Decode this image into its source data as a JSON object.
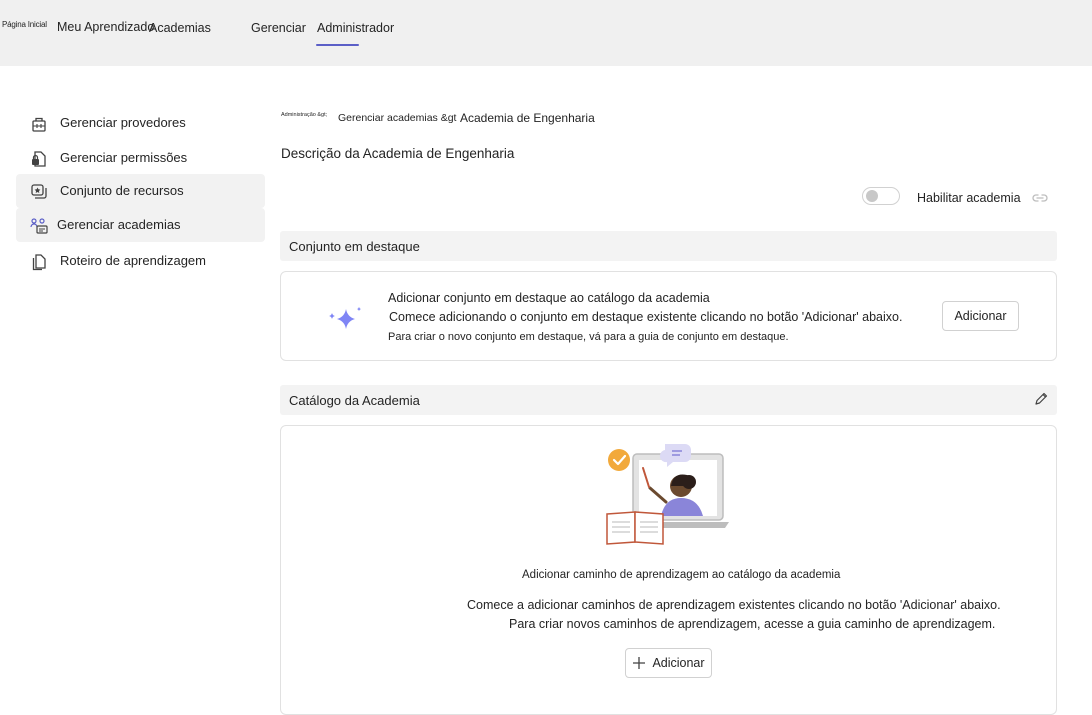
{
  "nav": {
    "home": "Página Inicial",
    "my_learning": "Meu Aprendizado",
    "academies": "Academias",
    "manage": "Gerenciar",
    "admin": "Administrador",
    "active_tab": "Administrador"
  },
  "sidebar": {
    "items": [
      {
        "label": "Gerenciar provedores",
        "icon": "providers-icon"
      },
      {
        "label": "Gerenciar permissões",
        "icon": "lock-document-icon"
      },
      {
        "label": "Conjunto de recursos",
        "icon": "collection-icon"
      },
      {
        "label": "Gerenciar academias",
        "icon": "people-manage-icon"
      },
      {
        "label": "Roteiro de aprendizagem",
        "icon": "document-copy-icon"
      }
    ],
    "active_items": [
      "Conjunto de recursos",
      "Gerenciar academias"
    ]
  },
  "breadcrumb": {
    "level1": "Administração &gt;",
    "level2": "Gerenciar academias &gt",
    "level3": "Academia de Engenharia"
  },
  "page": {
    "title": "Descrição da Academia de Engenharia",
    "toggle_label": "Habilitar academia",
    "toggle_on": false
  },
  "featured": {
    "header": "Conjunto em destaque",
    "title": "Adicionar conjunto em destaque ao catálogo da academia",
    "description": "Comece adicionando o conjunto em destaque existente clicando no botão 'Adicionar' abaixo.",
    "note": "Para criar o novo conjunto em destaque, vá para a guia de conjunto em destaque.",
    "button": "Adicionar"
  },
  "catalog": {
    "header": "Catálogo da Academia",
    "title": "Adicionar caminho de aprendizagem ao catálogo da academia",
    "description": "Comece a adicionar caminhos de aprendizagem existentes clicando no botão 'Adicionar' abaixo.",
    "note": "Para criar novos caminhos de aprendizagem, acesse a guia caminho de aprendizagem.",
    "button": "Adicionar"
  },
  "colors": {
    "accent": "#5b5fc7",
    "sparkle": "#7f85f5",
    "topbar_bg": "#f0f0f0",
    "section_bg": "#f3f3f3"
  }
}
